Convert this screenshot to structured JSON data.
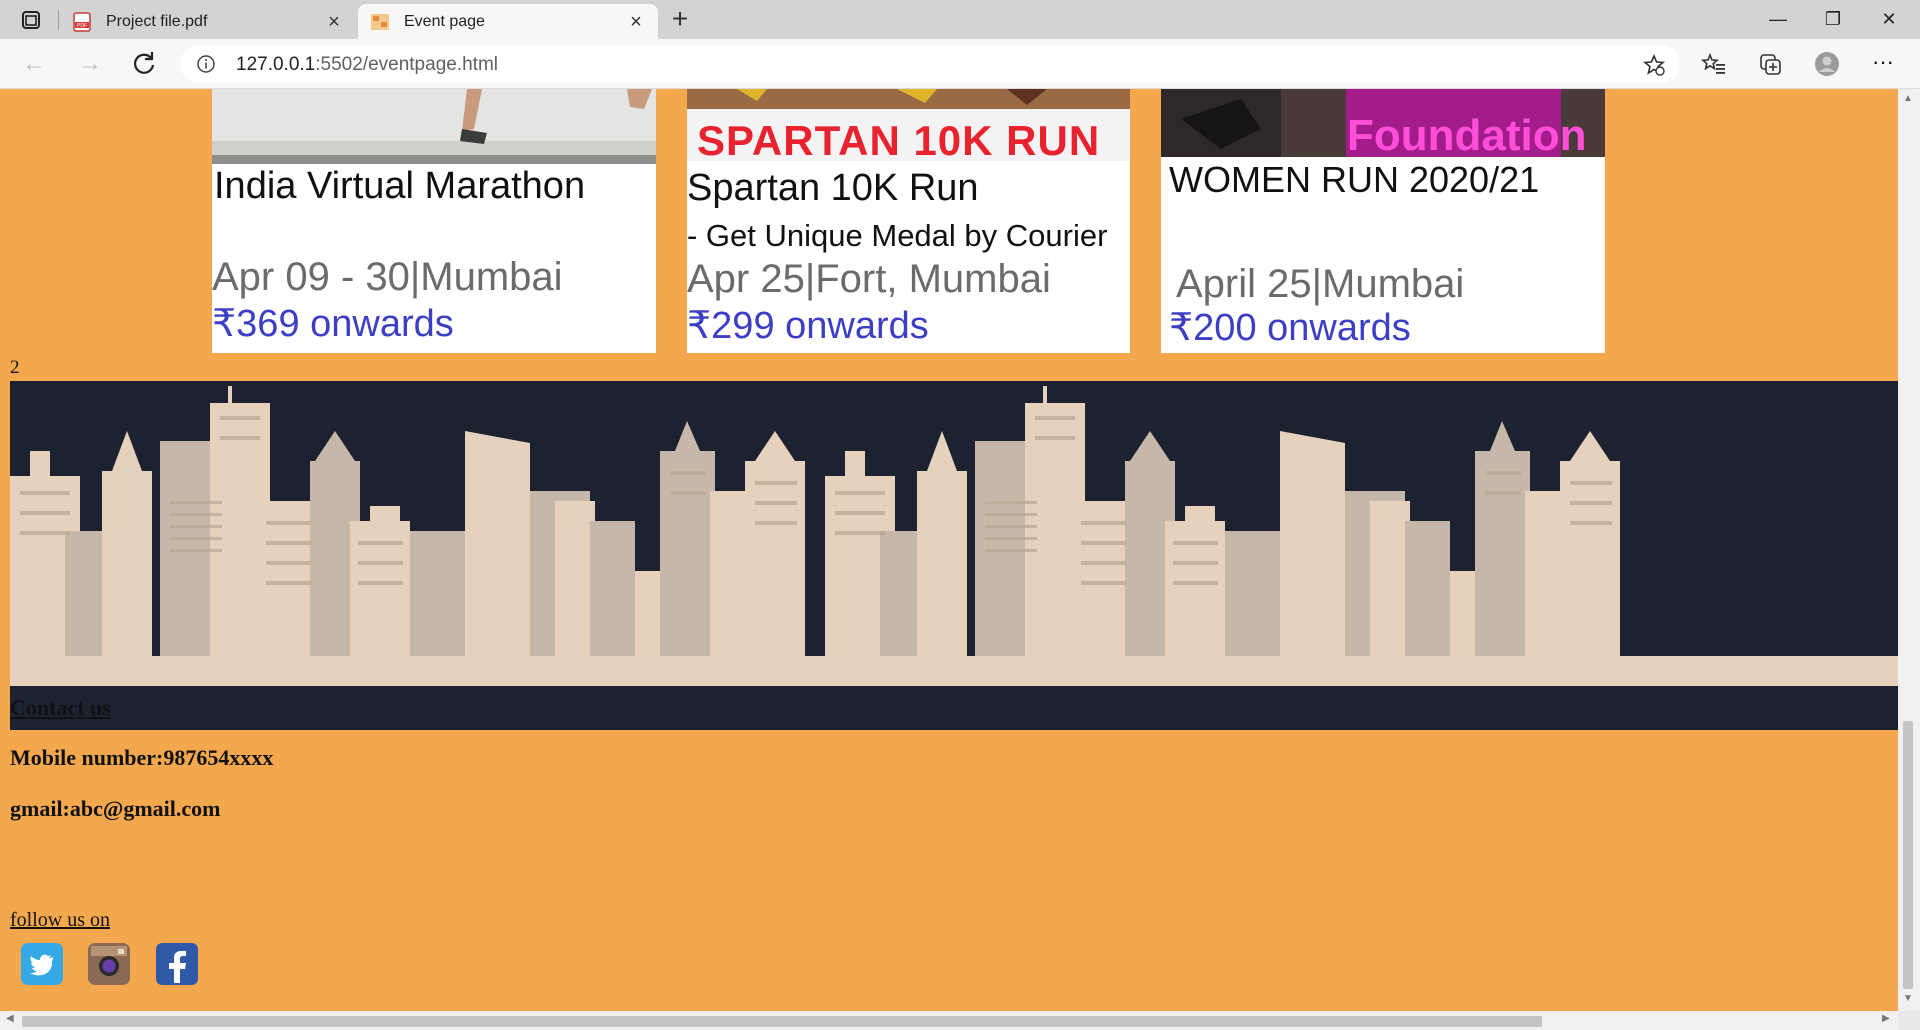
{
  "browser": {
    "tabs": [
      {
        "title": "Project file.pdf",
        "icon": "pdf-icon",
        "active": false
      },
      {
        "title": "Event page",
        "icon": "page-favicon",
        "active": true
      }
    ],
    "url_host": "127.0.0.1",
    "url_rest": ":5502/eventpage.html"
  },
  "events": [
    {
      "banner": "",
      "name": "India Virtual Marathon",
      "subtitle": "",
      "date_place": "Apr 09 - 30|Mumbai",
      "price": "₹369 onwards"
    },
    {
      "banner": "SPARTAN 10K RUN",
      "name": "Spartan 10K Run",
      "subtitle": " - Get Unique Medal by Courier",
      "date_place": "Apr 25|Fort, Mumbai",
      "price": "₹299 onwards"
    },
    {
      "banner": "Foundation",
      "name": "WOMEN RUN 2020/21",
      "subtitle": "",
      "date_place": "April 25|Mumbai",
      "price": "₹200 onwards"
    }
  ],
  "counter": "2",
  "contact": {
    "heading": "Contact us",
    "mobile": "Mobile number:987654xxxx",
    "email": "gmail:abc@gmail.com",
    "follow": "follow us on"
  },
  "social": [
    "twitter-icon",
    "instagram-icon",
    "facebook-icon"
  ],
  "colors": {
    "page_bg": "#f4a84d",
    "skyline_bg": "#1c2230",
    "building_light": "#e6d2bc",
    "building_dark": "#c6b8a8",
    "price_blue": "#3c3fc4",
    "banner_red": "#e8232f"
  }
}
